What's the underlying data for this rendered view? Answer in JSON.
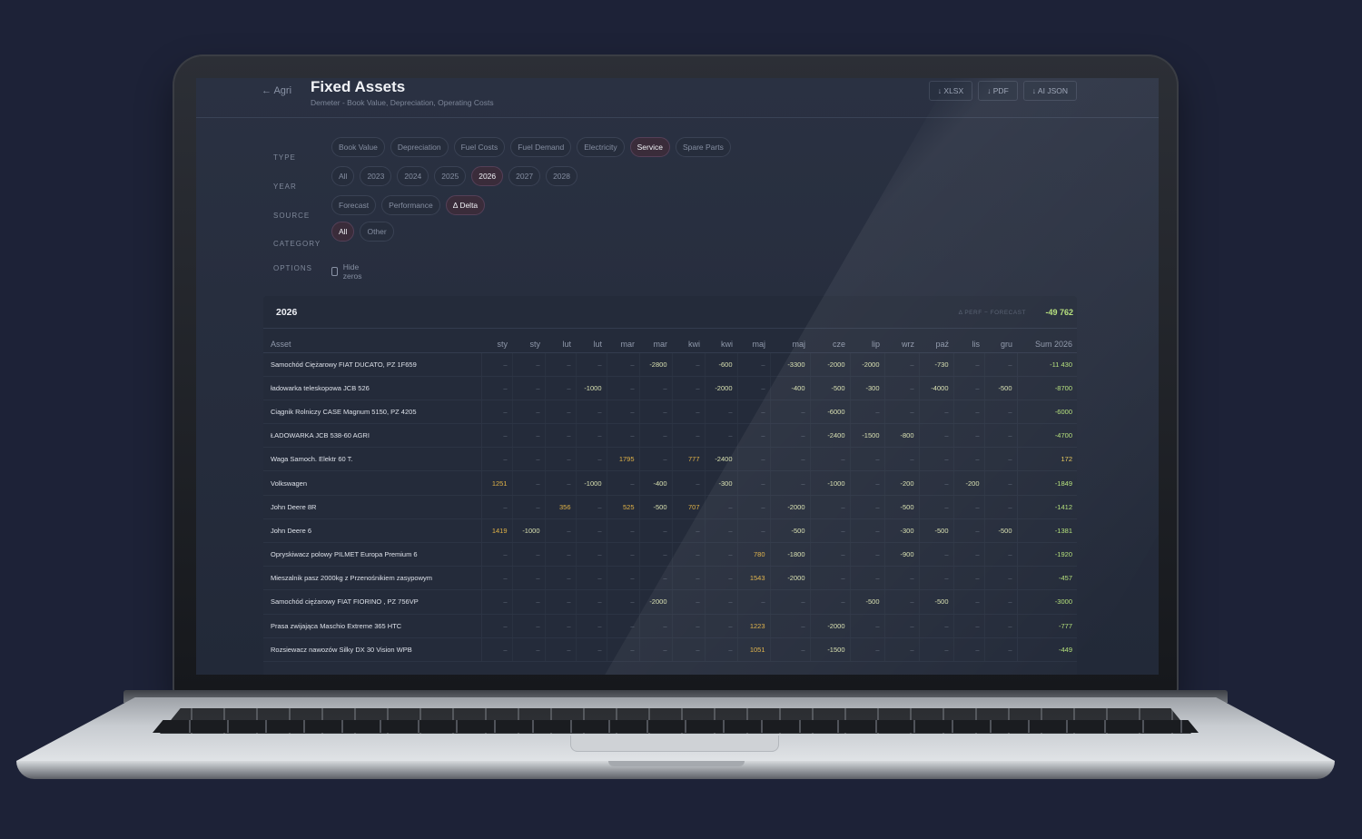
{
  "header": {
    "back_label": "← Agri",
    "title": "Fixed Assets",
    "subtitle": "Demeter - Book Value, Depreciation, Operating Costs",
    "exports": [
      "↓ XLSX",
      "↓ PDF",
      "↓ AI JSON"
    ]
  },
  "filters": {
    "type": {
      "label": "TYPE",
      "options": [
        "Book Value",
        "Depreciation",
        "Fuel Costs",
        "Fuel Demand",
        "Electricity",
        "Service",
        "Spare Parts"
      ],
      "selected": "Service"
    },
    "year": {
      "label": "YEAR",
      "options": [
        "All",
        "2023",
        "2024",
        "2025",
        "2026",
        "2027",
        "2028"
      ],
      "selected": "2026"
    },
    "source": {
      "label": "SOURCE",
      "options": [
        "Forecast",
        "Performance",
        "Δ Delta"
      ],
      "selected": "Δ Delta"
    },
    "category": {
      "label": "CATEGORY",
      "options": [
        "All",
        "Other"
      ],
      "selected": "All"
    },
    "options": {
      "label": "OPTIONS",
      "hide_zeros_label": "Hide zeros",
      "hide_zeros_checked": false
    }
  },
  "table": {
    "year": "2026",
    "delta_label": "Δ PERF − FORECAST",
    "delta_total": "-49 762",
    "columns": [
      "Asset",
      "sty",
      "sty",
      "lut",
      "lut",
      "mar",
      "mar",
      "kwi",
      "kwi",
      "maj",
      "maj",
      "cze",
      "lip",
      "wrz",
      "paź",
      "lis",
      "gru",
      "Sum 2026"
    ],
    "rows": [
      {
        "asset": "Samochód Ciężarowy FIAT DUCATO, PZ 1F659",
        "cells": [
          "–",
          "–",
          "–",
          "–",
          "–",
          "-2800",
          "–",
          "-600",
          "–",
          "-3300",
          "-2000",
          "-2000",
          "–",
          "-730",
          "–",
          "–"
        ],
        "sum": "-11 430"
      },
      {
        "asset": "ładowarka teleskopowa JCB 526",
        "cells": [
          "–",
          "–",
          "–",
          "-1000",
          "–",
          "–",
          "–",
          "-2000",
          "–",
          "-400",
          "-500",
          "-300",
          "–",
          "-4000",
          "–",
          "-500"
        ],
        "sum": "-8700"
      },
      {
        "asset": "Ciągnik Rolniczy CASE Magnum 5150, PZ 4205",
        "cells": [
          "–",
          "–",
          "–",
          "–",
          "–",
          "–",
          "–",
          "–",
          "–",
          "–",
          "-6000",
          "–",
          "–",
          "–",
          "–",
          "–"
        ],
        "sum": "-6000"
      },
      {
        "asset": "ŁADOWARKA JCB 538-60 AGRI",
        "cells": [
          "–",
          "–",
          "–",
          "–",
          "–",
          "–",
          "–",
          "–",
          "–",
          "–",
          "-2400",
          "-1500",
          "-800",
          "–",
          "–",
          "–"
        ],
        "sum": "-4700"
      },
      {
        "asset": "Waga Samoch. Elektr 60 T.",
        "cells": [
          "–",
          "–",
          "–",
          "–",
          "1795",
          "–",
          "777",
          "-2400",
          "–",
          "–",
          "–",
          "–",
          "–",
          "–",
          "–",
          "–"
        ],
        "sum": "172"
      },
      {
        "asset": "Volkswagen",
        "cells": [
          "1251",
          "–",
          "–",
          "-1000",
          "–",
          "-400",
          "–",
          "-300",
          "–",
          "–",
          "-1000",
          "–",
          "-200",
          "–",
          "-200",
          "–"
        ],
        "sum": "-1849"
      },
      {
        "asset": "John Deere 8R",
        "cells": [
          "–",
          "–",
          "356",
          "–",
          "525",
          "-500",
          "707",
          "–",
          "–",
          "-2000",
          "–",
          "–",
          "-500",
          "–",
          "–",
          "–"
        ],
        "sum": "-1412"
      },
      {
        "asset": "John Deere 6",
        "cells": [
          "1419",
          "-1000",
          "–",
          "–",
          "–",
          "–",
          "–",
          "–",
          "–",
          "-500",
          "–",
          "–",
          "-300",
          "-500",
          "–",
          "-500"
        ],
        "sum": "-1381"
      },
      {
        "asset": "Opryskiwacz polowy PILMET Europa Premium 6",
        "cells": [
          "–",
          "–",
          "–",
          "–",
          "–",
          "–",
          "–",
          "–",
          "780",
          "-1800",
          "–",
          "–",
          "-900",
          "–",
          "–",
          "–"
        ],
        "sum": "-1920"
      },
      {
        "asset": "Mieszalnik pasz 2000kg z Przenośnikiem zasypowym",
        "cells": [
          "–",
          "–",
          "–",
          "–",
          "–",
          "–",
          "–",
          "–",
          "1543",
          "-2000",
          "–",
          "–",
          "–",
          "–",
          "–",
          "–"
        ],
        "sum": "-457"
      },
      {
        "asset": "Samochód ciężarowy FIAT FIORINO , PZ 756VP",
        "cells": [
          "–",
          "–",
          "–",
          "–",
          "–",
          "-2000",
          "–",
          "–",
          "–",
          "–",
          "–",
          "-500",
          "–",
          "-500",
          "–",
          "–"
        ],
        "sum": "-3000"
      },
      {
        "asset": "Prasa zwijająca Maschio Extreme 365 HTC",
        "cells": [
          "–",
          "–",
          "–",
          "–",
          "–",
          "–",
          "–",
          "–",
          "1223",
          "–",
          "-2000",
          "–",
          "–",
          "–",
          "–",
          "–"
        ],
        "sum": "-777"
      },
      {
        "asset": "Rozsiewacz nawozów Silky DX 30 Vision WPB",
        "cells": [
          "–",
          "–",
          "–",
          "–",
          "–",
          "–",
          "–",
          "–",
          "1051",
          "–",
          "-1500",
          "–",
          "–",
          "–",
          "–",
          "–"
        ],
        "sum": "-449"
      }
    ]
  }
}
